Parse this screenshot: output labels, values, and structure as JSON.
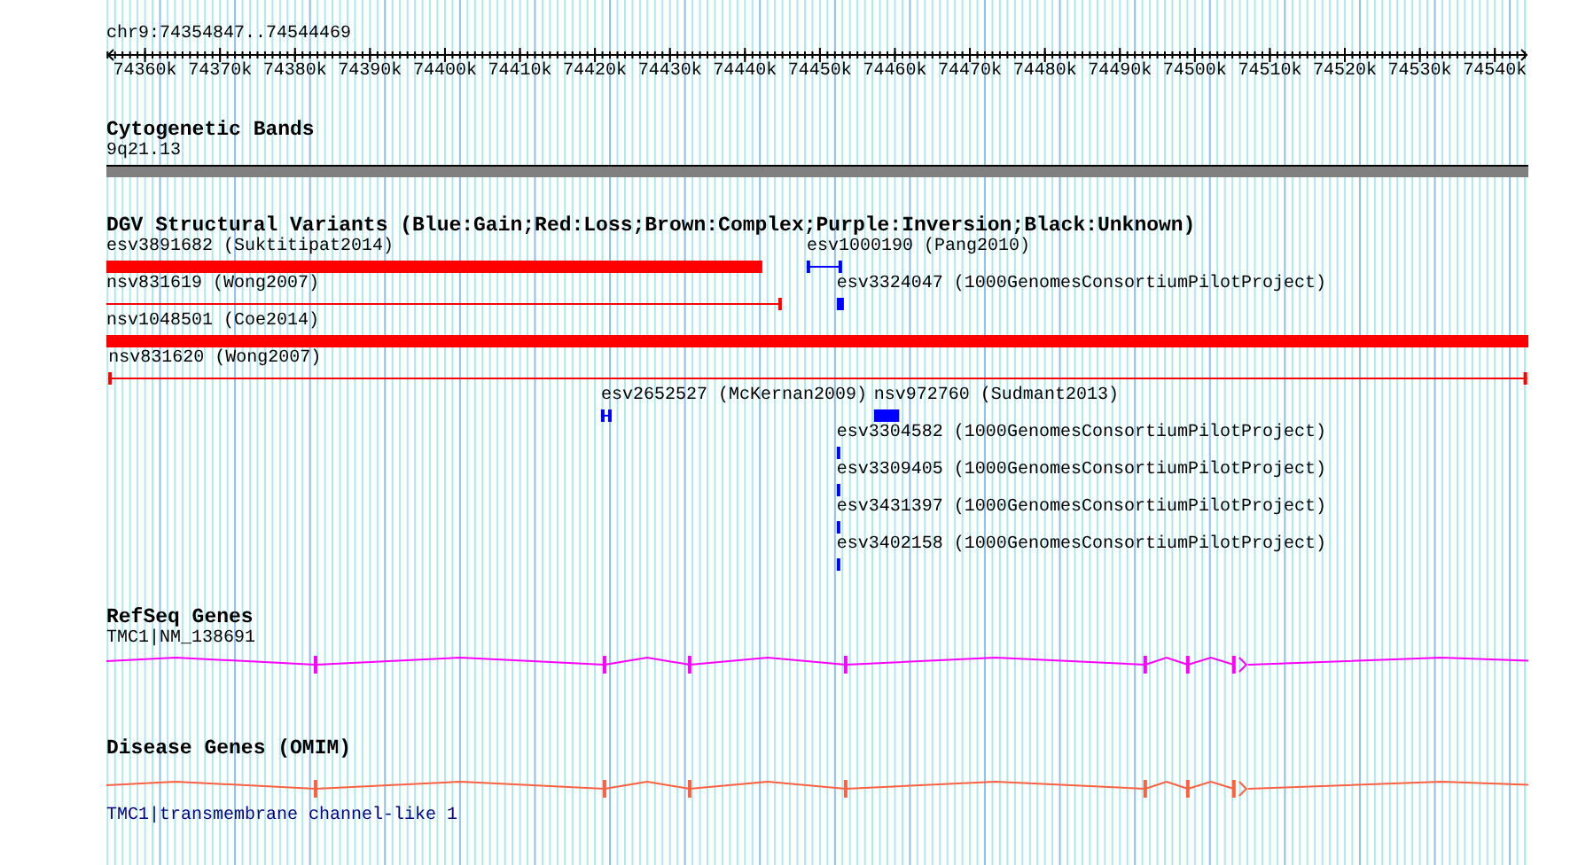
{
  "ruler": {
    "position": "chr9:74354847..74544469",
    "ticks": [
      "74360k",
      "74370k",
      "74380k",
      "74390k",
      "74400k",
      "74410k",
      "74420k",
      "74430k",
      "74440k",
      "74450k",
      "74460k",
      "74470k",
      "74480k",
      "74490k",
      "74500k",
      "74510k",
      "74520k",
      "74530k",
      "74540k"
    ]
  },
  "cytogenetic_bands": {
    "title": "Cytogenetic Bands",
    "band_label": "9q21.13"
  },
  "dgv_variants": {
    "title": "DGV Structural Variants (Blue:Gain;Red:Loss;Brown:Complex;Purple:Inversion;Black:Unknown)",
    "rows": [
      {
        "features": [
          {
            "label": "esv3891682 (Suktitipat2014)",
            "kind": "box",
            "color": "#ff0000"
          },
          {
            "label": "esv1000190 (Pang2010)",
            "kind": "line",
            "color": "#0000ff"
          }
        ]
      },
      {
        "features": [
          {
            "label": "nsv831619 (Wong2007)",
            "kind": "line",
            "color": "#ff0000"
          },
          {
            "label": "esv3324047 (1000GenomesConsortiumPilotProject)",
            "kind": "box",
            "color": "#0000ff"
          }
        ]
      },
      {
        "features": [
          {
            "label": "nsv1048501 (Coe2014)",
            "kind": "box",
            "color": "#ff0000"
          }
        ]
      },
      {
        "features": [
          {
            "label": "nsv831620 (Wong2007)",
            "kind": "line",
            "color": "#ff0000"
          }
        ]
      },
      {
        "features": [
          {
            "label": "esv2652527 (McKernan2009)",
            "kind": "line",
            "color": "#0000ff"
          },
          {
            "label": "nsv972760 (Sudmant2013)",
            "kind": "box",
            "color": "#0000ff"
          }
        ]
      },
      {
        "features": [
          {
            "label": "esv3304582 (1000GenomesConsortiumPilotProject)",
            "kind": "box",
            "color": "#0000ff"
          }
        ]
      },
      {
        "features": [
          {
            "label": "esv3309405 (1000GenomesConsortiumPilotProject)",
            "kind": "box",
            "color": "#0000ff"
          }
        ]
      },
      {
        "features": [
          {
            "label": "esv3431397 (1000GenomesConsortiumPilotProject)",
            "kind": "box",
            "color": "#0000ff"
          }
        ]
      },
      {
        "features": [
          {
            "label": "esv3402158 (1000GenomesConsortiumPilotProject)",
            "kind": "box",
            "color": "#0000ff"
          }
        ]
      }
    ]
  },
  "refseq_genes": {
    "title": "RefSeq Genes",
    "gene_label": "TMC1|NM_138691"
  },
  "disease_genes": {
    "title": "Disease Genes (OMIM)",
    "gene_label": "TMC1|transmembrane channel-like 1"
  }
}
